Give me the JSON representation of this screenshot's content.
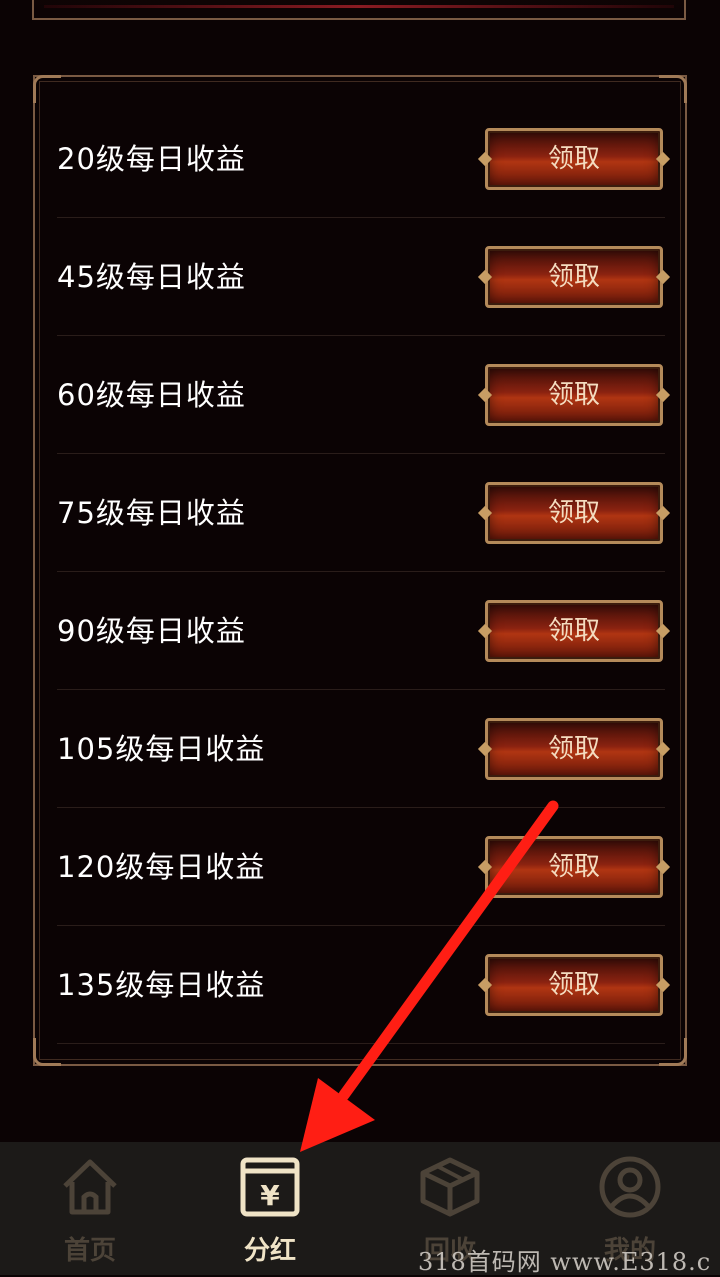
{
  "rows": [
    {
      "label": "20级每日收益",
      "button": "领取"
    },
    {
      "label": "45级每日收益",
      "button": "领取"
    },
    {
      "label": "60级每日收益",
      "button": "领取"
    },
    {
      "label": "75级每日收益",
      "button": "领取"
    },
    {
      "label": "90级每日收益",
      "button": "领取"
    },
    {
      "label": "105级每日收益",
      "button": "领取"
    },
    {
      "label": "120级每日收益",
      "button": "领取"
    },
    {
      "label": "135级每日收益",
      "button": "领取"
    }
  ],
  "nav": [
    {
      "label": "首页",
      "icon": "home-icon",
      "active": false
    },
    {
      "label": "分红",
      "icon": "dividend-icon",
      "active": true
    },
    {
      "label": "回收",
      "icon": "box-icon",
      "active": false
    },
    {
      "label": "我的",
      "icon": "user-icon",
      "active": false
    }
  ],
  "colors": {
    "active_nav": "#efe3c6",
    "inactive_nav": "#4c4338",
    "annotation_arrow": "#ff1e14",
    "frame": "#7a5a43"
  },
  "watermark": "318首码网 www.E318.c"
}
